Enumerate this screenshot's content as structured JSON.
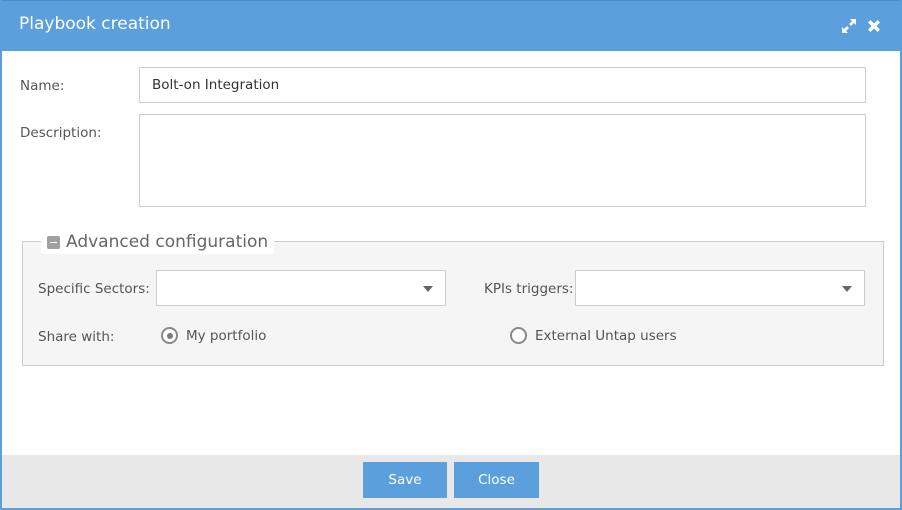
{
  "dialog": {
    "title": "Playbook creation",
    "expand_icon": "expand-arrows-icon",
    "close_icon": "close-x-icon"
  },
  "form": {
    "name_label": "Name:",
    "name_value": "Bolt-on Integration",
    "description_label": "Description:",
    "description_value": ""
  },
  "advanced": {
    "legend": "Advanced configuration",
    "toggle_icon": "minus-square-icon",
    "sectors_label": "Specific Sectors:",
    "sectors_value": "",
    "kpis_label": "KPIs triggers:",
    "kpis_value": "",
    "share_label": "Share with:",
    "share_options": [
      {
        "label": "My portfolio",
        "selected": true
      },
      {
        "label": "External Untap users",
        "selected": false
      }
    ]
  },
  "footer": {
    "save_label": "Save",
    "close_label": "Close"
  },
  "colors": {
    "accent": "#5b9fdc",
    "panel_bg": "#f5f5f5",
    "footer_bg": "#e8e8e8"
  }
}
